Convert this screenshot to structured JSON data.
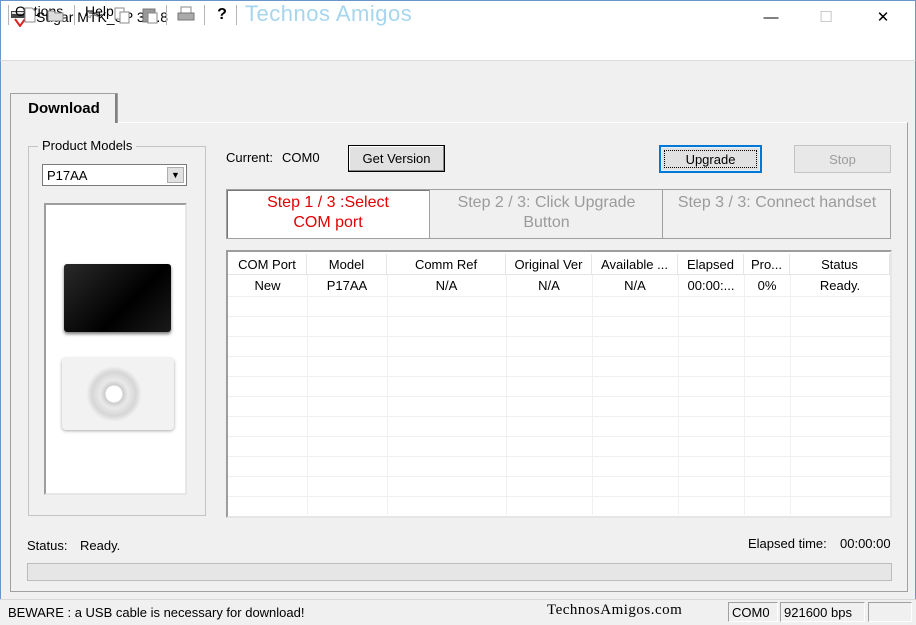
{
  "window": {
    "title": "Sugar MTK_SP 3.5.8"
  },
  "menu": {
    "options": "Options",
    "help": "Help"
  },
  "toolbar": {
    "brand": "Technos Amigos",
    "help_glyph": "?"
  },
  "tabs": {
    "download": "Download"
  },
  "product_models": {
    "label": "Product Models",
    "selected": "P17AA"
  },
  "current": {
    "label": "Current:",
    "value": "COM0"
  },
  "buttons": {
    "get_version": "Get Version",
    "upgrade": "Upgrade",
    "stop": "Stop"
  },
  "steps": {
    "step1_line1": "Step 1 / 3 :Select",
    "step1_line2": "COM port",
    "step2_line1": "Step 2 / 3: Click Upgrade",
    "step2_line2": "Button",
    "step3_line1": "Step 3 / 3: Connect handset"
  },
  "table": {
    "headers": [
      "COM Port",
      "Model",
      "Comm Ref",
      "Original Ver",
      "Available ...",
      "Elapsed",
      "Pro...",
      "Status"
    ],
    "rows": [
      [
        "New",
        "P17AA",
        "N/A",
        "N/A",
        "N/A",
        "00:00:...",
        "0%",
        "Ready."
      ]
    ]
  },
  "status": {
    "label": "Status:",
    "value": "Ready.",
    "elapsed_label": "Elapsed time:",
    "elapsed_value": "00:00:00",
    "progress": 0
  },
  "statusbar": {
    "message": "BEWARE : a USB cable is necessary for download!",
    "watermark": "TechnosAmigos.com",
    "com": "COM0",
    "baud": "921600 bps"
  },
  "colors": {
    "step_active": "#e20000",
    "step_inactive": "#9b9b9b",
    "brand": "#a6d6ee",
    "upgrade_focus": "#0078d7"
  }
}
